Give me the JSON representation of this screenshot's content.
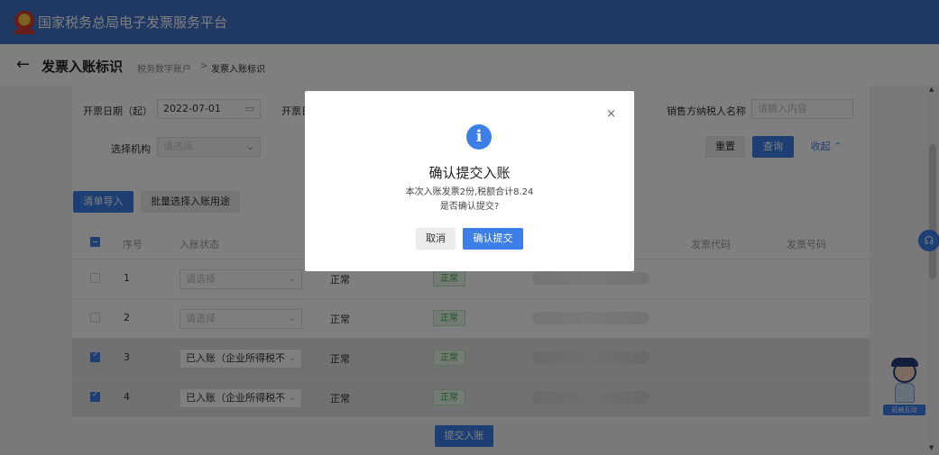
{
  "header": {
    "title": "国家税务总局电子发票服务平台"
  },
  "subheader": {
    "page_title": "发票入账标识",
    "breadcrumb": [
      "税务数字账户",
      "发票入账标识"
    ],
    "breadcrumb_sep": ">"
  },
  "filters": {
    "start_date_label": "开票日期（起）",
    "start_date_value": "2022-07-01",
    "end_date_label_partial": "开票日",
    "seller_name_label": "销售方纳税人名称",
    "seller_name_placeholder": "请输入内容",
    "org_label": "选择机构",
    "org_placeholder": "请选择",
    "reset_label": "重置",
    "search_label": "查询",
    "collapse_label": "收起"
  },
  "actions": {
    "import_label": "清单导入",
    "batch_label": "批量选择入账用途"
  },
  "table": {
    "columns": [
      "序号",
      "入账状态",
      "发票代码",
      "发票号码"
    ],
    "rows": [
      {
        "seq": "1",
        "entry_status": "请选择",
        "status": "正常",
        "tag": "正常",
        "checked": false
      },
      {
        "seq": "2",
        "entry_status": "请选择",
        "status": "正常",
        "tag": "正常",
        "checked": false
      },
      {
        "seq": "3",
        "entry_status": "已入账（企业所得税不",
        "status": "正常",
        "tag": "正常",
        "checked": true
      },
      {
        "seq": "4",
        "entry_status": "已入账（企业所得税不",
        "status": "正常",
        "tag": "正常",
        "checked": true
      }
    ]
  },
  "footer": {
    "submit_label": "提交入账"
  },
  "modal": {
    "title": "确认提交入账",
    "line1": "本次入账发票2份,税额合计8.24",
    "line2": "是否确认提交?",
    "cancel_label": "取消",
    "confirm_label": "确认提交",
    "close_glyph": "×",
    "info_glyph": "i"
  },
  "side": {
    "assistant_label": "征纳互动"
  },
  "icons": {
    "back": "arrow-left-icon",
    "calendar": "calendar-icon",
    "chevron": "chevron-down-icon",
    "collapse": "chevron-up-icon",
    "info": "info-icon",
    "close": "close-icon",
    "headset": "headset-icon"
  },
  "colors": {
    "topbar": "#3f72c7",
    "primary": "#3d7ee8",
    "success": "#39a84a"
  }
}
